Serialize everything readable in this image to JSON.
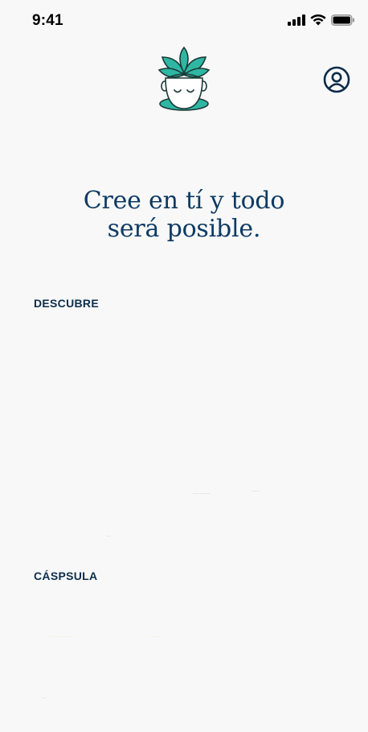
{
  "status_bar": {
    "time": "9:41",
    "icons": [
      "signal-icon",
      "wifi-icon",
      "battery-icon"
    ]
  },
  "header": {
    "logo_icon": "meditating-head-lotus-logo",
    "profile_icon": "user-profile-icon"
  },
  "quote": {
    "line1": "Cree en tí y todo",
    "line2": "será posible."
  },
  "sections": {
    "descubre": {
      "title": "DESCUBRE"
    },
    "capsula": {
      "title": "CÁSPSULA"
    }
  },
  "colors": {
    "background": "#f8f8f8",
    "primary_text": "#0d3a63",
    "heading_text": "#0d2e4c",
    "leaf_teal": "#2fb7a4",
    "leaf_outline": "#1b3a36"
  }
}
